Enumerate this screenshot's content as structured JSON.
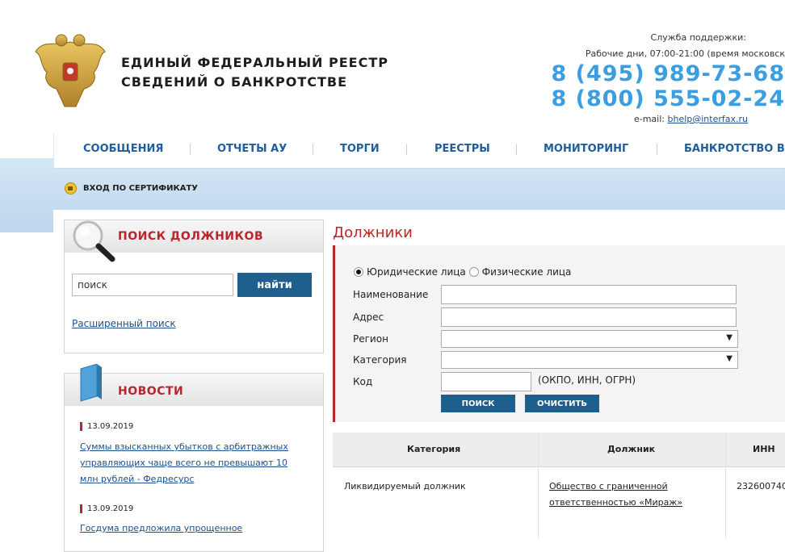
{
  "header": {
    "brand_line1": "ЕДИНЫЙ ФЕДЕРАЛЬНЫЙ РЕЕСТР",
    "brand_line2": "СВЕДЕНИЙ О БАНКРОТСТВЕ",
    "support_label": "Служба поддержки:",
    "support_hours": "Рабочие дни, 07:00-21:00 (время московск",
    "phone1": "8 (495) 989-73-68",
    "phone2": "8 (800) 555-02-24",
    "email_label": "e-mail:",
    "email": "bhelp@interfax.ru"
  },
  "nav": [
    {
      "label": "СООБЩЕНИЯ"
    },
    {
      "label": "ОТЧЕТЫ АУ"
    },
    {
      "label": "ТОРГИ"
    },
    {
      "label": "РЕЕСТРЫ"
    },
    {
      "label": "МОНИТОРИНГ"
    },
    {
      "label": "БАНКРОТСТВО В"
    }
  ],
  "cert_login": "ВХОД ПО СЕРТИФИКАТУ",
  "search_panel": {
    "title": "ПОИСК ДОЛЖНИКОВ",
    "input_value": "поиск",
    "button": "найти",
    "advanced_link": "Расширенный поиск"
  },
  "news_panel": {
    "title": "НОВОСТИ",
    "items": [
      {
        "date": "13.09.2019",
        "text": "Суммы взысканных убытков с арбитражных управляющих чаще всего не превышают 10 млн рублей - Федресурс"
      },
      {
        "date": "13.09.2019",
        "text": "Госдума предложила упрощенное"
      }
    ]
  },
  "content": {
    "title": "Должники",
    "radio_legal": "Юридические лица",
    "radio_individual": "Физические лица",
    "label_name": "Наименование",
    "label_address": "Адрес",
    "label_region": "Регион",
    "label_category": "Категория",
    "label_code": "Код",
    "code_hint": "(ОКПО, ИНН, ОГРН)",
    "btn_search": "ПОИСК",
    "btn_clear": "ОЧИСТИТЬ"
  },
  "table": {
    "headers": [
      "Категория",
      "Должник",
      "ИНН"
    ],
    "rows": [
      {
        "category": "Ликвидируемый должник",
        "debtor": "Общество с граниченной ответственностью «Мираж»",
        "inn": "232600740"
      }
    ]
  }
}
